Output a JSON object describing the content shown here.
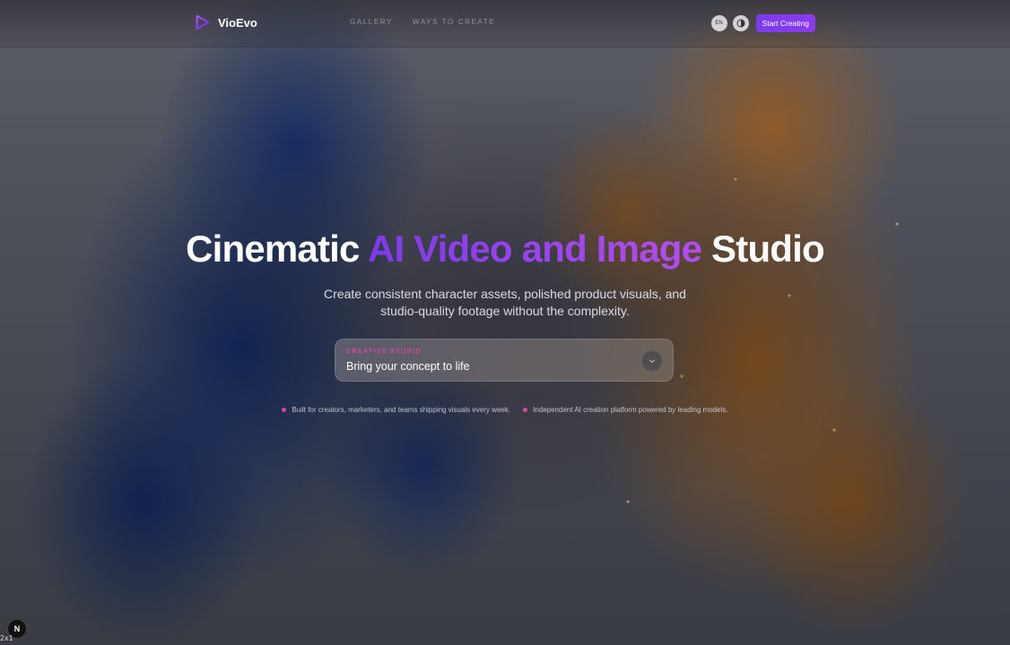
{
  "header": {
    "brand": "VioEvo",
    "nav": [
      {
        "label": "GALLERY"
      },
      {
        "label": "WAYS TO CREATE"
      }
    ],
    "language_label": "EN",
    "cta_label": "Start Creating"
  },
  "hero": {
    "title_before": "Cinematic ",
    "title_accent": "AI Video and Image",
    "title_after": " Studio",
    "subtitle": "Create consistent character assets, polished product visuals, and studio-quality footage without the complexity."
  },
  "prompt": {
    "label": "CREATIVE STUDIO",
    "value": "Bring your concept to life"
  },
  "bullets": [
    {
      "text": "Built for creators, marketers, and teams shipping visuals every week."
    },
    {
      "text": "Independent AI creation platform powered by leading models."
    }
  ],
  "dev": {
    "badge": "N",
    "zoom": "2x1"
  },
  "colors": {
    "accent": "#7c3aed",
    "accent_light": "#b14ef2",
    "bullet_dot": "#e0449e"
  }
}
